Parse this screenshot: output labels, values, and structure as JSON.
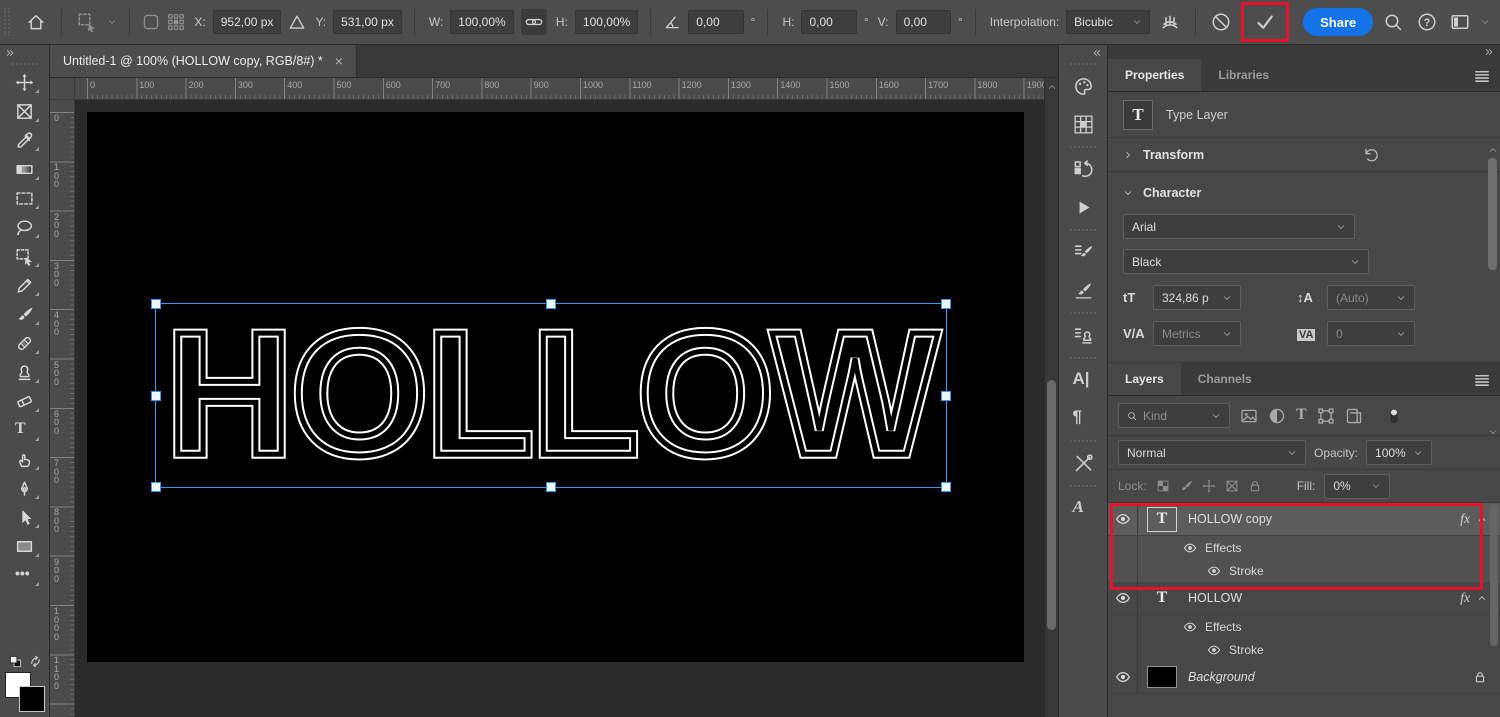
{
  "options_bar": {
    "x_label": "X:",
    "x_value": "952,00 px",
    "y_label": "Y:",
    "y_value": "531,00 px",
    "w_label": "W:",
    "w_value": "100,00%",
    "h_label": "H:",
    "h_value": "100,00%",
    "rotation_value": "0,00",
    "h_skew_label": "H:",
    "h_skew_value": "0,00",
    "v_skew_label": "V:",
    "v_skew_value": "0,00",
    "degree": "°",
    "interpolation_label": "Interpolation:",
    "interpolation_value": "Bicubic",
    "share_label": "Share"
  },
  "document_tab": {
    "title": "Untitled-1 @ 100% (HOLLOW copy, RGB/8#) *",
    "close": "×"
  },
  "canvas": {
    "text": "HOLLOW"
  },
  "rulers": {
    "horizontal": [
      "0",
      "100",
      "200",
      "300",
      "400",
      "500",
      "600",
      "700",
      "800",
      "900",
      "1000",
      "1100",
      "1200",
      "1300",
      "1400",
      "1500",
      "1600",
      "1700",
      "1800",
      "1900"
    ],
    "vertical": [
      "0",
      "100",
      "200",
      "300",
      "400",
      "500",
      "600",
      "700",
      "800",
      "900",
      "1000",
      "1100"
    ]
  },
  "tools": [
    "move",
    "artboard",
    "eyedropper",
    "gradient",
    "marquee",
    "lasso",
    "object-selection",
    "pencil",
    "brush",
    "healing-brush",
    "clone-stamp",
    "eraser",
    "type",
    "smudge",
    "pen",
    "path-select",
    "shape",
    "more-tools"
  ],
  "dock": [
    [
      "color",
      "swatches"
    ],
    [
      "history",
      "actions"
    ],
    [
      "brush-settings",
      "brushes"
    ],
    [
      "clone-source"
    ],
    [
      "character",
      "paragraph"
    ],
    [
      "tool-presets"
    ],
    [
      "glyphs"
    ]
  ],
  "properties_panel": {
    "tabs": [
      "Properties",
      "Libraries"
    ],
    "layer_type": "Type Layer",
    "transform_label": "Transform",
    "character_label": "Character",
    "font_family": "Arial",
    "font_style": "Black",
    "font_size": "324,86 p",
    "leading": "(Auto)",
    "kerning": "Metrics",
    "tracking": "0"
  },
  "character_icons": {
    "size": "tT",
    "leading": "↕A",
    "kerning": "V/A",
    "tracking": "VA"
  },
  "layers_panel": {
    "tabs": [
      "Layers",
      "Channels"
    ],
    "filter_label": "Kind",
    "blend_mode": "Normal",
    "opacity_label": "Opacity:",
    "opacity_value": "100%",
    "lock_label": "Lock:",
    "fill_label": "Fill:",
    "fill_value": "0%",
    "fx_label": "fx",
    "layers": [
      {
        "name": "HOLLOW copy",
        "kind": "type",
        "selected": true,
        "has_fx": true,
        "children": [
          "Effects",
          "Stroke"
        ]
      },
      {
        "name": "HOLLOW",
        "kind": "type",
        "selected": false,
        "has_fx": true,
        "children": [
          "Effects",
          "Stroke"
        ]
      },
      {
        "name": "Background",
        "kind": "background",
        "selected": false,
        "locked": true,
        "children": []
      }
    ]
  },
  "colors": {
    "share_blue": "#1473e6",
    "selection_blue": "#2e9bf5",
    "annotation_red": "#e8112d"
  }
}
